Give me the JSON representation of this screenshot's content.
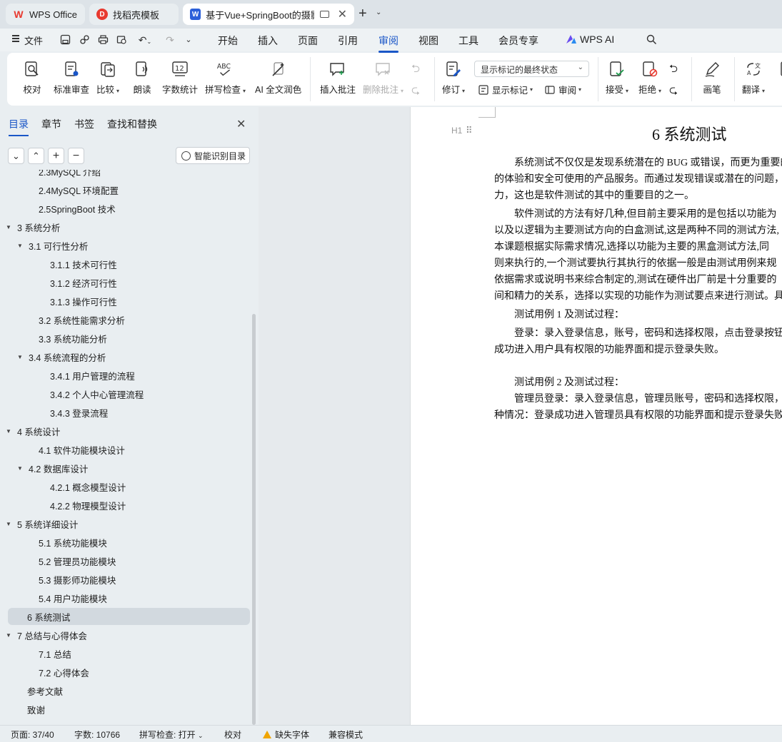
{
  "tabs": [
    {
      "label": "WPS Office",
      "icon": "wps-logo-icon",
      "color": "#e8392f"
    },
    {
      "label": "找稻壳模板",
      "icon": "docer-logo-icon",
      "color": "#e8392f"
    },
    {
      "label": "基于Vue+SpringBoot的摄影",
      "icon": "writer-doc-icon",
      "color": "#2b5fd9"
    }
  ],
  "menu": {
    "file": "文件",
    "items": [
      "开始",
      "插入",
      "页面",
      "引用",
      "审阅",
      "视图",
      "工具",
      "会员专享",
      "WPS AI"
    ],
    "active": "审阅"
  },
  "ribbon": {
    "buttons": [
      "校对",
      "标准审查",
      "比较",
      "朗读",
      "字数统计",
      "拼写检查",
      "AI 全文润色",
      "插入批注",
      "删除批注",
      "修订",
      "接受",
      "拒绝",
      "画笔",
      "翻译"
    ],
    "markup_select": "显示标记的最终状态",
    "show_markup": "显示标记",
    "review": "审阅"
  },
  "nav": {
    "tabs": [
      "目录",
      "章节",
      "书签",
      "查找和替换"
    ],
    "smart_toc": "智能识别目录",
    "toc": [
      {
        "label": "2.3MySQL 介绍",
        "level": 2
      },
      {
        "label": "2.4MySQL 环境配置",
        "level": 2
      },
      {
        "label": "2.5SpringBoot 技术",
        "level": 2
      },
      {
        "label": "3 系统分析",
        "level": 1
      },
      {
        "label": "3.1 可行性分析",
        "level": 2
      },
      {
        "label": "3.1.1 技术可行性",
        "level": 3
      },
      {
        "label": "3.1.2 经济可行性",
        "level": 3
      },
      {
        "label": "3.1.3 操作可行性",
        "level": 3
      },
      {
        "label": "3.2 系统性能需求分析",
        "level": 2
      },
      {
        "label": "3.3 系统功能分析",
        "level": 2
      },
      {
        "label": "3.4 系统流程的分析",
        "level": 2
      },
      {
        "label": "3.4.1  用户管理的流程",
        "level": 3
      },
      {
        "label": "3.4.2 个人中心管理流程",
        "level": 3
      },
      {
        "label": "3.4.3 登录流程",
        "level": 3
      },
      {
        "label": "4 系统设计",
        "level": 1
      },
      {
        "label": "4.1  软件功能模块设计",
        "level": 2
      },
      {
        "label": "4.2 数据库设计",
        "level": 2
      },
      {
        "label": "4.2.1 概念模型设计",
        "level": 3
      },
      {
        "label": "4.2.2 物理模型设计",
        "level": 3
      },
      {
        "label": "5 系统详细设计",
        "level": 1
      },
      {
        "label": "5.1 系统功能模块",
        "level": 2
      },
      {
        "label": "5.2 管理员功能模块",
        "level": 2
      },
      {
        "label": "5.3 摄影师功能模块",
        "level": 2
      },
      {
        "label": "5.4 用户功能模块",
        "level": 2
      },
      {
        "label": "6 系统测试",
        "level": 1
      },
      {
        "label": "7 总结与心得体会",
        "level": 1
      },
      {
        "label": "7.1  总结",
        "level": 2
      },
      {
        "label": "7.2  心得体会",
        "level": 2
      },
      {
        "label": "参考文献",
        "level": 1
      },
      {
        "label": "致谢",
        "level": 1
      }
    ],
    "selected": "6 系统测试"
  },
  "document": {
    "heading_tag": "H1",
    "title": "6 系统测试",
    "lines": [
      "系统测试不仅仅是发现系统潜在的 BUG 或错误，而更为重要的",
      "的体验和安全可使用的产品服务。而通过发现错误或潜在的问题，",
      "力，这也是软件测试的其中的重要目的之一。",
      "软件测试的方法有好几种,但目前主要采用的是包括以功能为",
      "以及以逻辑为主要测试方向的白盒测试,这是两种不同的测试方法,",
      "本课题根据实际需求情况,选择以功能为主要的黑盒测试方法,同",
      "则来执行的,一个测试要执行其执行的依据一般是由测试用例来规",
      "依据需求或说明书来综合制定的,测试在硬件出厂前是十分重要的",
      "间和精力的关系，选择以实现的功能作为测试要点来进行测试。具",
      "测试用例 1 及测试过程：",
      "登录：录入登录信息，账号，密码和选择权限，点击登录按钮",
      "成功进入用户具有权限的功能界面和提示登录失败。",
      "测试用例 2 及测试过程：",
      "管理员登录：录入登录信息，管理员账号，密码和选择权限，",
      "种情况：登录成功进入管理员具有权限的功能界面和提示登录失败"
    ]
  },
  "status": {
    "page": "页面: 37/40",
    "words": "字数: 10766",
    "spell": "拼写检查: 打开",
    "proof": "校对",
    "missing_font": "缺失字体",
    "compat": "兼容模式"
  },
  "colors": {
    "accent": "#1a56c7",
    "wps_red": "#e8392f",
    "writer_blue": "#2b5fd9",
    "warning": "#f0a500"
  }
}
